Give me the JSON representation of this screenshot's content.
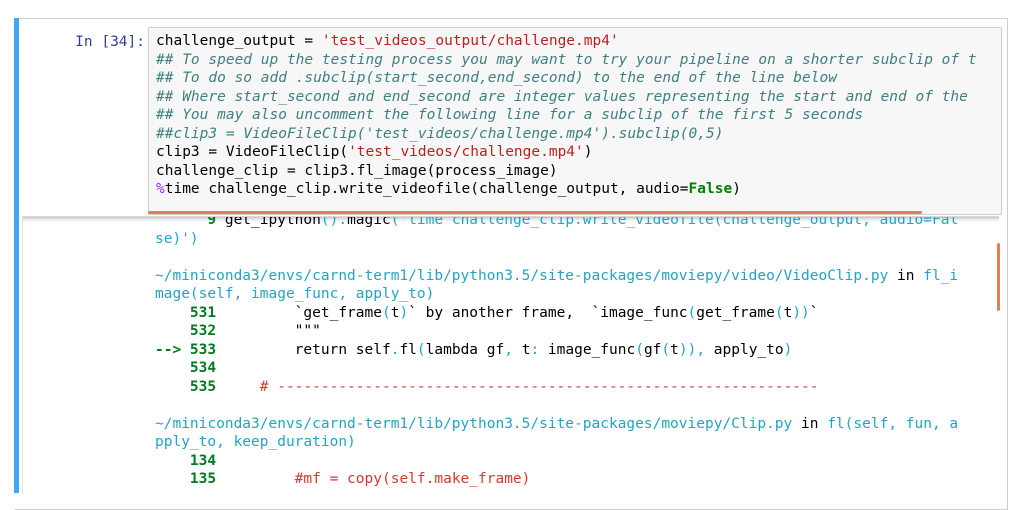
{
  "prompt": "In [34]:",
  "input_lines": [
    [
      {
        "t": "challenge_output = ",
        "c": ""
      },
      {
        "t": "'test_videos_output/challenge.mp4'",
        "c": "c-str"
      }
    ],
    [
      {
        "t": "## To speed up the testing process you may want to try your pipeline on a shorter subclip of t",
        "c": "c-cmt"
      }
    ],
    [
      {
        "t": "## To do so add .subclip(start_second,end_second) to the end of the line below",
        "c": "c-cmt"
      }
    ],
    [
      {
        "t": "## Where start_second and end_second are integer values representing the start and end of the",
        "c": "c-cmt"
      }
    ],
    [
      {
        "t": "## You may also uncomment the following line for a subclip of the first 5 seconds",
        "c": "c-cmt"
      }
    ],
    [
      {
        "t": "##clip3 = VideoFileClip('test_videos/challenge.mp4').subclip(0,5)",
        "c": "c-cmt"
      }
    ],
    [
      {
        "t": "clip3 = VideoFileClip(",
        "c": ""
      },
      {
        "t": "'test_videos/challenge.mp4'",
        "c": "c-str"
      },
      {
        "t": ")",
        "c": ""
      }
    ],
    [
      {
        "t": "challenge_clip = clip3.fl_image(process_image)",
        "c": ""
      }
    ],
    [
      {
        "t": "%",
        "c": "c-mag"
      },
      {
        "t": "time challenge_clip.write_videofile(challenge_output, audio=",
        "c": ""
      },
      {
        "t": "False",
        "c": "c-kw"
      },
      {
        "t": ")",
        "c": ""
      }
    ]
  ],
  "output_lines": [
    [
      {
        "t": "      9 ",
        "c": "o-grn"
      },
      {
        "t": "get_ipython",
        "c": "o-blk"
      },
      {
        "t": "().",
        "c": "o-cyan"
      },
      {
        "t": "magic",
        "c": "o-blk"
      },
      {
        "t": "('time challenge_clip.write_videofile(challenge_output, audio=Fal",
        "c": "o-cyan"
      }
    ],
    [
      {
        "t": "se)')",
        "c": "o-cyan"
      }
    ],
    [
      {
        "t": "",
        "c": ""
      }
    ],
    [
      {
        "t": "~/miniconda3/envs/carnd-term1/lib/python3.5/site-packages/moviepy/video/VideoClip.py",
        "c": "o-cyan"
      },
      {
        "t": " in ",
        "c": "o-blk"
      },
      {
        "t": "fl_i",
        "c": "o-cyan"
      }
    ],
    [
      {
        "t": "mage(self, image_func, apply_to)",
        "c": "o-cyan"
      }
    ],
    [
      {
        "t": "    531 ",
        "c": "o-grn"
      },
      {
        "t": "        `get_frame",
        "c": "o-blk"
      },
      {
        "t": "(",
        "c": "o-cyan"
      },
      {
        "t": "t",
        "c": "o-blk"
      },
      {
        "t": ")",
        "c": "o-cyan"
      },
      {
        "t": "` by another frame,  `image_func",
        "c": "o-blk"
      },
      {
        "t": "(",
        "c": "o-cyan"
      },
      {
        "t": "get_frame",
        "c": "o-blk"
      },
      {
        "t": "(",
        "c": "o-cyan"
      },
      {
        "t": "t",
        "c": "o-blk"
      },
      {
        "t": "))",
        "c": "o-cyan"
      },
      {
        "t": "`",
        "c": "o-blk"
      }
    ],
    [
      {
        "t": "    532 ",
        "c": "o-grn"
      },
      {
        "t": "        \"\"\"",
        "c": "o-blk"
      }
    ],
    [
      {
        "t": "--> 533 ",
        "c": "o-grn"
      },
      {
        "t": "        return ",
        "c": "o-blk"
      },
      {
        "t": "self",
        "c": "o-blk"
      },
      {
        "t": ".",
        "c": "o-cyan"
      },
      {
        "t": "fl",
        "c": "o-blk"
      },
      {
        "t": "(",
        "c": "o-cyan"
      },
      {
        "t": "lambda gf",
        "c": "o-blk"
      },
      {
        "t": ",",
        "c": "o-cyan"
      },
      {
        "t": " t",
        "c": "o-blk"
      },
      {
        "t": ":",
        "c": "o-cyan"
      },
      {
        "t": " image_func",
        "c": "o-blk"
      },
      {
        "t": "(",
        "c": "o-cyan"
      },
      {
        "t": "gf",
        "c": "o-blk"
      },
      {
        "t": "(",
        "c": "o-cyan"
      },
      {
        "t": "t",
        "c": "o-blk"
      },
      {
        "t": "))",
        "c": "o-cyan"
      },
      {
        "t": ",",
        "c": "o-cyan"
      },
      {
        "t": " apply_to",
        "c": "o-blk"
      },
      {
        "t": ")",
        "c": "o-cyan"
      }
    ],
    [
      {
        "t": "    534 ",
        "c": "o-grn"
      }
    ],
    [
      {
        "t": "    535 ",
        "c": "o-grn"
      },
      {
        "t": "    # --------------------------------------------------------------",
        "c": "o-red"
      }
    ],
    [
      {
        "t": "",
        "c": ""
      }
    ],
    [
      {
        "t": "~/miniconda3/envs/carnd-term1/lib/python3.5/site-packages/moviepy/Clip.py",
        "c": "o-cyan"
      },
      {
        "t": " in ",
        "c": "o-blk"
      },
      {
        "t": "fl(self, fun, a",
        "c": "o-cyan"
      }
    ],
    [
      {
        "t": "pply_to, keep_duration)",
        "c": "o-cyan"
      }
    ],
    [
      {
        "t": "    134 ",
        "c": "o-grn"
      }
    ],
    [
      {
        "t": "    135 ",
        "c": "o-grn"
      },
      {
        "t": "        #mf = copy(self.make_frame)",
        "c": "o-red"
      }
    ]
  ],
  "colors": {
    "cell_bar": "#42a5f5",
    "prompt": "#303f9f",
    "string": "#ba2121",
    "comment": "#408080",
    "keyword": "#008000",
    "scrollbar": "#e57d59"
  }
}
